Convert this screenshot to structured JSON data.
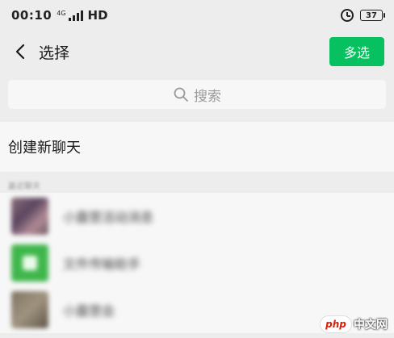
{
  "status_bar": {
    "time": "00:10",
    "network_label": "4G",
    "hd_label": "HD",
    "battery": "37",
    "icons": [
      "signal-icon",
      "alarm-icon",
      "battery-icon"
    ]
  },
  "header": {
    "title": "选择",
    "multi_select_label": "多选",
    "back_icon": "chevron-left-icon",
    "accent_color": "#07c160"
  },
  "search": {
    "placeholder": "搜索",
    "icon": "search-icon"
  },
  "new_chat": {
    "label": "创建新聊天"
  },
  "recent": {
    "section_label": "最近聊天",
    "items": [
      {
        "name": "小露营活动消息"
      },
      {
        "name": "文件传输助手"
      },
      {
        "name": "小露营会"
      }
    ]
  },
  "watermark": {
    "badge": "php",
    "text": "中文网"
  }
}
